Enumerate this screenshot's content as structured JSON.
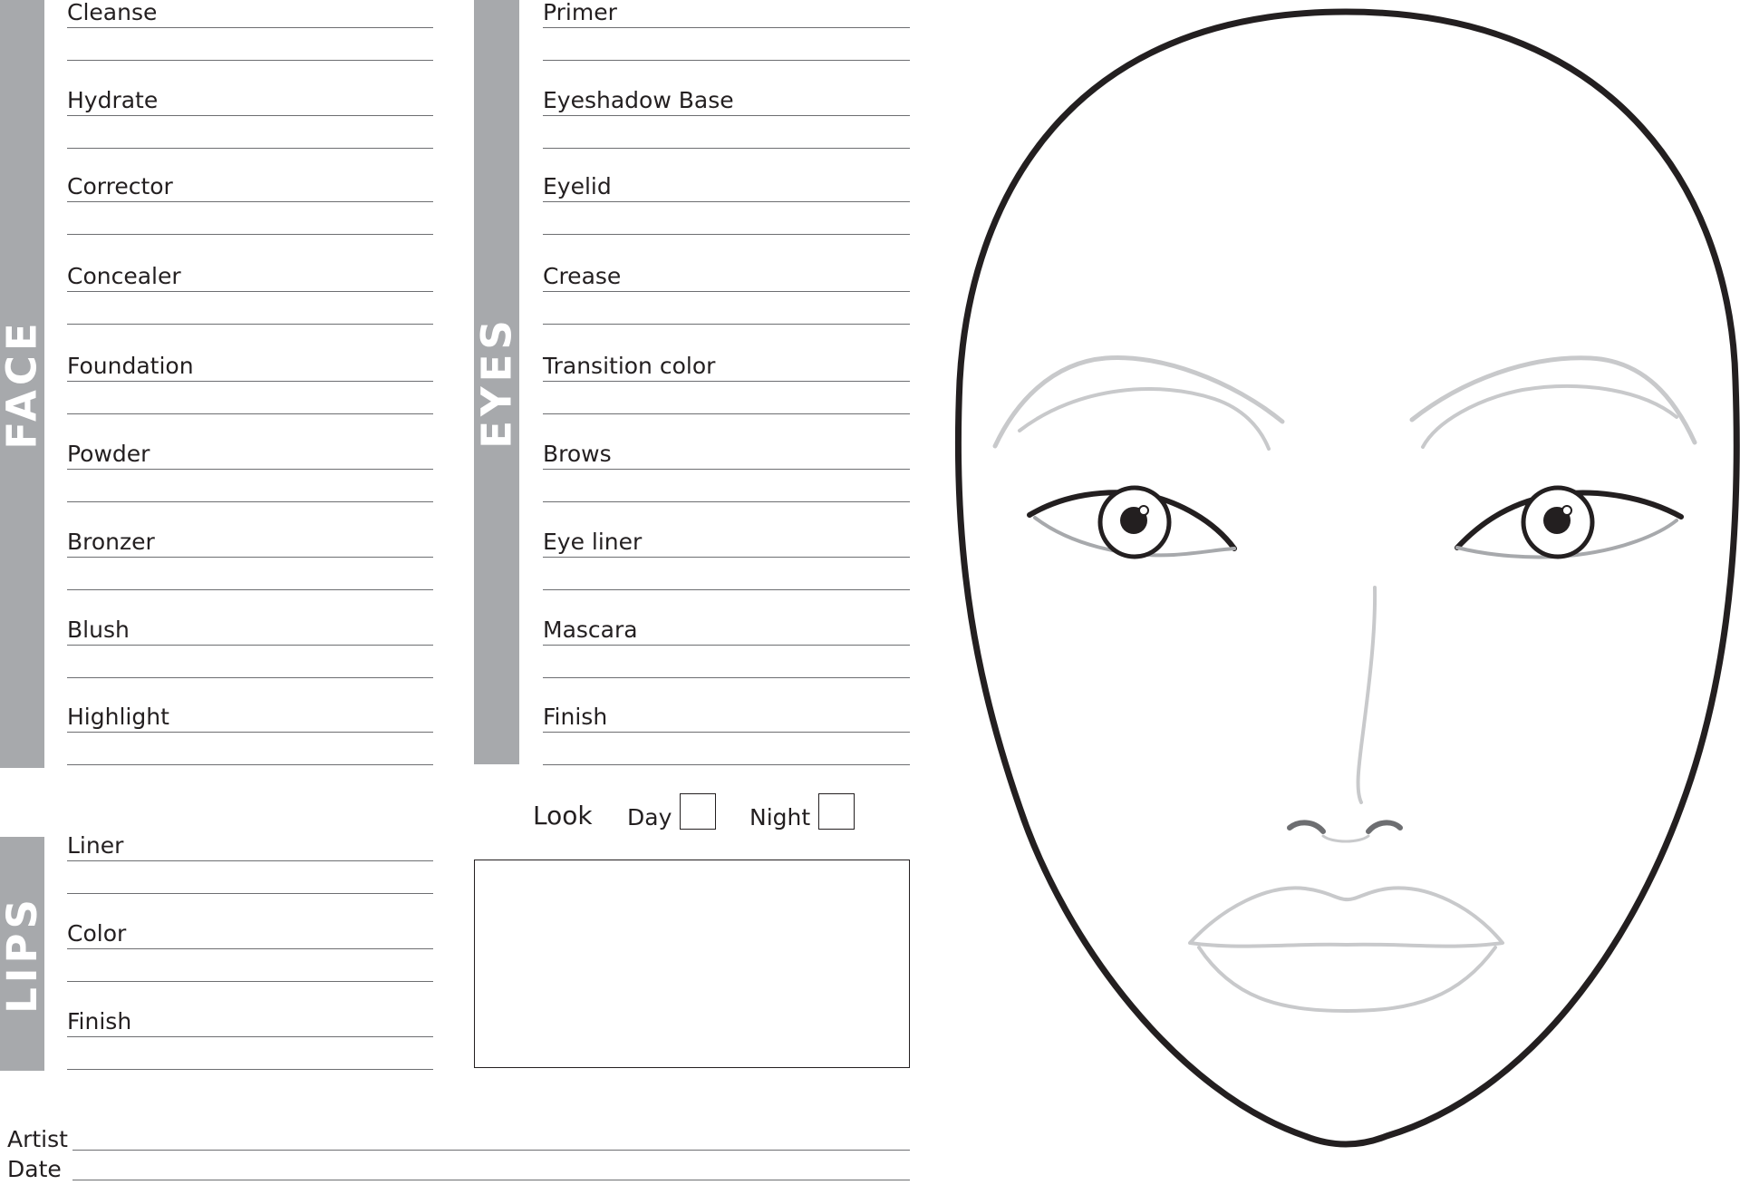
{
  "sections": {
    "face": {
      "title": "FACE",
      "items": [
        "Cleanse",
        "Hydrate",
        "Corrector",
        "Concealer",
        "Foundation",
        "Powder",
        "Bronzer",
        "Blush",
        "Highlight"
      ]
    },
    "eyes": {
      "title": "EYES",
      "items": [
        "Primer",
        "Eyeshadow Base",
        "Eyelid",
        "Crease",
        "Transition color",
        "Brows",
        "Eye liner",
        "Mascara",
        "Finish"
      ]
    },
    "lips": {
      "title": "LIPS",
      "items": [
        "Liner",
        "Color",
        "Finish"
      ]
    }
  },
  "look": {
    "label": "Look",
    "options": [
      {
        "label": "Day",
        "checked": false
      },
      {
        "label": "Night",
        "checked": false
      }
    ]
  },
  "signature": {
    "artist_label": "Artist",
    "date_label": "Date"
  },
  "colors": {
    "section_band": "#a7a9ac",
    "face_outline": "#231f20",
    "feature_guides": "#c8c9cb"
  }
}
